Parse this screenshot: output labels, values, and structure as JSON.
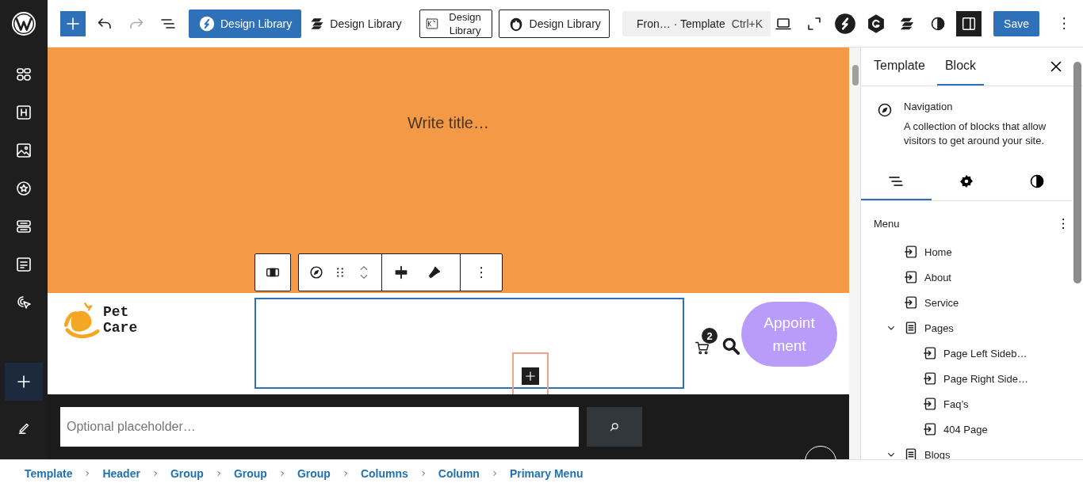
{
  "top_bar": {
    "design_library_buttons": [
      {
        "kind": "primary",
        "label": "Design Library"
      },
      {
        "kind": "plain",
        "label": "Design Library"
      },
      {
        "kind": "outlined",
        "label": "Design Library"
      },
      {
        "kind": "outlined",
        "label": "Design Library"
      }
    ],
    "command_bar": {
      "label": "Fron… · Template",
      "shortcut": "Ctrl+K"
    },
    "save_button": "Save"
  },
  "canvas": {
    "title_placeholder": "Write title…",
    "logo_lines": [
      "Pet",
      "Care"
    ],
    "cart_count": "2",
    "appointment_lines": [
      "Appoint",
      "ment"
    ],
    "search_placeholder": "Optional placeholder…"
  },
  "inspector": {
    "tabs": [
      {
        "label": "Template",
        "selected": false
      },
      {
        "label": "Block",
        "selected": true
      }
    ],
    "block": {
      "title": "Navigation",
      "description": "A collection of blocks that allow visitors to get around your site."
    },
    "sub_tabs": [
      {
        "kind": "list",
        "selected": true
      },
      {
        "kind": "settings",
        "selected": false
      },
      {
        "kind": "styles",
        "selected": false
      }
    ],
    "menu_label": "Menu",
    "menu_items": [
      {
        "kind": "link",
        "label": "Home"
      },
      {
        "kind": "link",
        "label": "About"
      },
      {
        "kind": "link",
        "label": "Service"
      },
      {
        "kind": "submenu",
        "label": "Pages",
        "expanded": true,
        "children": [
          {
            "kind": "link",
            "label": "Page Left Sideb…"
          },
          {
            "kind": "link",
            "label": "Page Right Side…"
          },
          {
            "kind": "link",
            "label": "Faq’s"
          },
          {
            "kind": "link",
            "label": "404 Page"
          }
        ]
      },
      {
        "kind": "submenu",
        "label": "Blogs",
        "expanded": true
      }
    ]
  },
  "breadcrumbs": [
    "Template",
    "Header",
    "Group",
    "Group",
    "Group",
    "Columns",
    "Column",
    "Primary Menu"
  ]
}
